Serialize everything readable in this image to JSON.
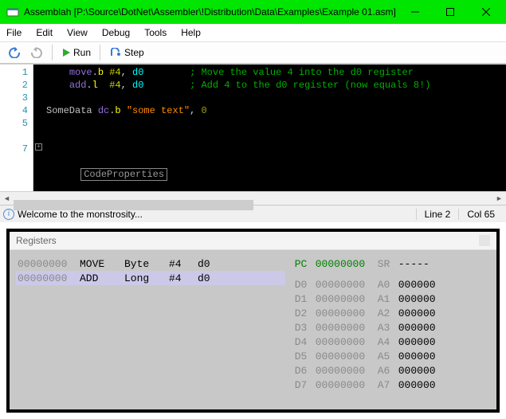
{
  "window": {
    "title": "Assemblah [P:\\Source\\DotNet\\Assembler\\!Distribution\\Data\\Examples\\Example 01.asm]"
  },
  "menu": {
    "file": "File",
    "edit": "Edit",
    "view": "View",
    "debug": "Debug",
    "tools": "Tools",
    "help": "Help"
  },
  "toolbar": {
    "run_label": "Run",
    "step_label": "Step"
  },
  "editor": {
    "lines": [
      "1",
      "2",
      "3",
      "4",
      "5",
      "",
      "7"
    ],
    "l1": {
      "indent": "    ",
      "op": "move",
      "dot": ".",
      "size": "b",
      "sp": " ",
      "imm": "#4",
      "comma": ", ",
      "reg": "d0",
      "pad": "        ",
      "cmt": "; Move the value 4 into the d0 register"
    },
    "l2": {
      "indent": "    ",
      "op": "add",
      "dot": ".",
      "size": "l",
      "sp": "  ",
      "imm": "#4",
      "comma": ", ",
      "reg": "d0",
      "pad": "        ",
      "cmt": "; Add 4 to the d0 register (now equals 8!)"
    },
    "l4": {
      "label": "SomeData ",
      "dir": "dc",
      "dot": ".",
      "size": "b",
      "sp": " ",
      "str": "\"some text\"",
      "comma": ", ",
      "num": "0"
    },
    "fold_label": "CodeProperties"
  },
  "status": {
    "message": "Welcome to the monstrosity...",
    "line": "Line 2",
    "col": "Col 65"
  },
  "panel": {
    "title": "Registers"
  },
  "dis": {
    "r0": {
      "addr": "00000000",
      "mn": "MOVE",
      "size": "Byte",
      "imm": "#4",
      "reg": "d0"
    },
    "r1": {
      "addr": "00000000",
      "mn": "ADD",
      "size": "Long",
      "imm": "#4",
      "reg": "d0"
    }
  },
  "regs": {
    "pc_label": "PC",
    "pc_value": "00000000",
    "sr_label": "SR",
    "sr_value": "-----",
    "d": [
      {
        "n": "D0",
        "v": "00000000"
      },
      {
        "n": "D1",
        "v": "00000000"
      },
      {
        "n": "D2",
        "v": "00000000"
      },
      {
        "n": "D3",
        "v": "00000000"
      },
      {
        "n": "D4",
        "v": "00000000"
      },
      {
        "n": "D5",
        "v": "00000000"
      },
      {
        "n": "D6",
        "v": "00000000"
      },
      {
        "n": "D7",
        "v": "00000000"
      }
    ],
    "a": [
      {
        "n": "A0",
        "v": "000000"
      },
      {
        "n": "A1",
        "v": "000000"
      },
      {
        "n": "A2",
        "v": "000000"
      },
      {
        "n": "A3",
        "v": "000000"
      },
      {
        "n": "A4",
        "v": "000000"
      },
      {
        "n": "A5",
        "v": "000000"
      },
      {
        "n": "A6",
        "v": "000000"
      },
      {
        "n": "A7",
        "v": "000000"
      }
    ]
  }
}
